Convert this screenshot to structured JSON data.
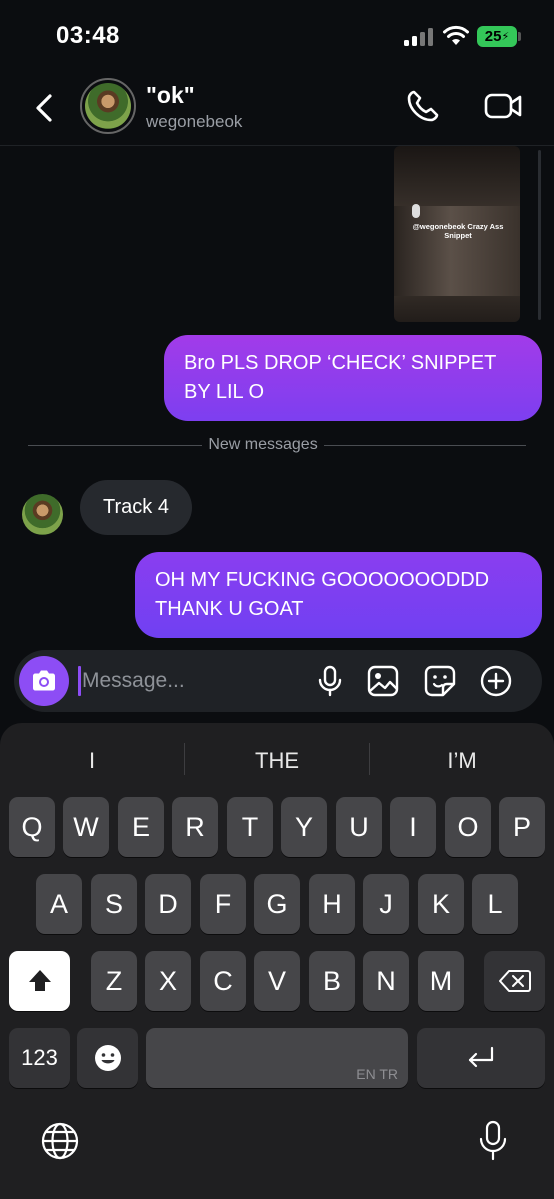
{
  "status_bar": {
    "time": "03:48",
    "battery": "25"
  },
  "header": {
    "name": "\"ok\"",
    "handle": "wegonebeok"
  },
  "media": {
    "caption": "@wegonebeok Crazy Ass Snippet"
  },
  "messages": {
    "outgoing_1": "Bro PLS DROP ‘CHECK’ SNIPPET BY LIL O",
    "divider": "New messages",
    "incoming_1": "Track 4",
    "outgoing_2": "OH MY FUCKING GOOOOOOODDD THANK U GOAT"
  },
  "composer": {
    "placeholder": "Message..."
  },
  "keyboard": {
    "suggestions": [
      "I",
      "THE",
      "I’M"
    ],
    "row1": [
      "Q",
      "W",
      "E",
      "R",
      "T",
      "Y",
      "U",
      "I",
      "O",
      "P"
    ],
    "row2": [
      "A",
      "S",
      "D",
      "F",
      "G",
      "H",
      "J",
      "K",
      "L"
    ],
    "row3": [
      "Z",
      "X",
      "C",
      "V",
      "B",
      "N",
      "M"
    ],
    "numbers_label": "123",
    "language_label": "EN TR"
  },
  "icons": [
    "back-chevron",
    "phone",
    "video-camera",
    "camera",
    "microphone",
    "gallery",
    "sticker",
    "plus",
    "shift",
    "backspace",
    "emoji",
    "return",
    "globe",
    "dictation"
  ]
}
